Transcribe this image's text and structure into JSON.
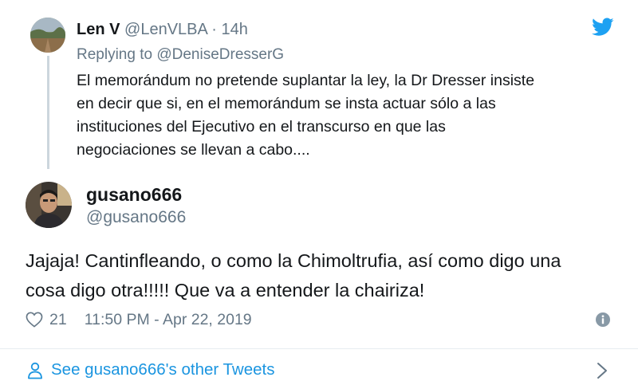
{
  "parent_tweet": {
    "name": "Len V",
    "handle": "@LenVLBA",
    "separator": "·",
    "time": "14h",
    "replying_prefix": "Replying to",
    "replying_handle": "@DeniseDresserG",
    "text_lines": [
      "El memorándum no pretende suplantar la ley, la Dr Dresser insiste",
      "en  decir que si, en el memorándum se insta  actuar sólo a las",
      "instituciones del Ejecutivo en el transcurso en que las",
      "negociaciones se llevan a cabo...."
    ]
  },
  "main_tweet": {
    "name": "gusano666",
    "handle": "@gusano666",
    "text_lines": [
      "Jajaja! Cantinfleando, o como la Chimoltrufia, así como digo una",
      "cosa digo otra!!!!! Que va a entender la chairiza!"
    ],
    "likes": "21",
    "timestamp": "11:50 PM - Apr 22, 2019"
  },
  "footer": {
    "label": "See gusano666's other Tweets"
  },
  "icons": {
    "brand": "twitter-bird-icon",
    "like": "heart-icon",
    "info": "info-icon",
    "profile": "person-icon",
    "more": "chevron-right-icon"
  },
  "colors": {
    "twitter_blue": "#1da1f2",
    "link_blue": "#1b95e0",
    "secondary_text": "#657786",
    "primary_text": "#14171a",
    "thread_line": "#ccd6dd"
  }
}
